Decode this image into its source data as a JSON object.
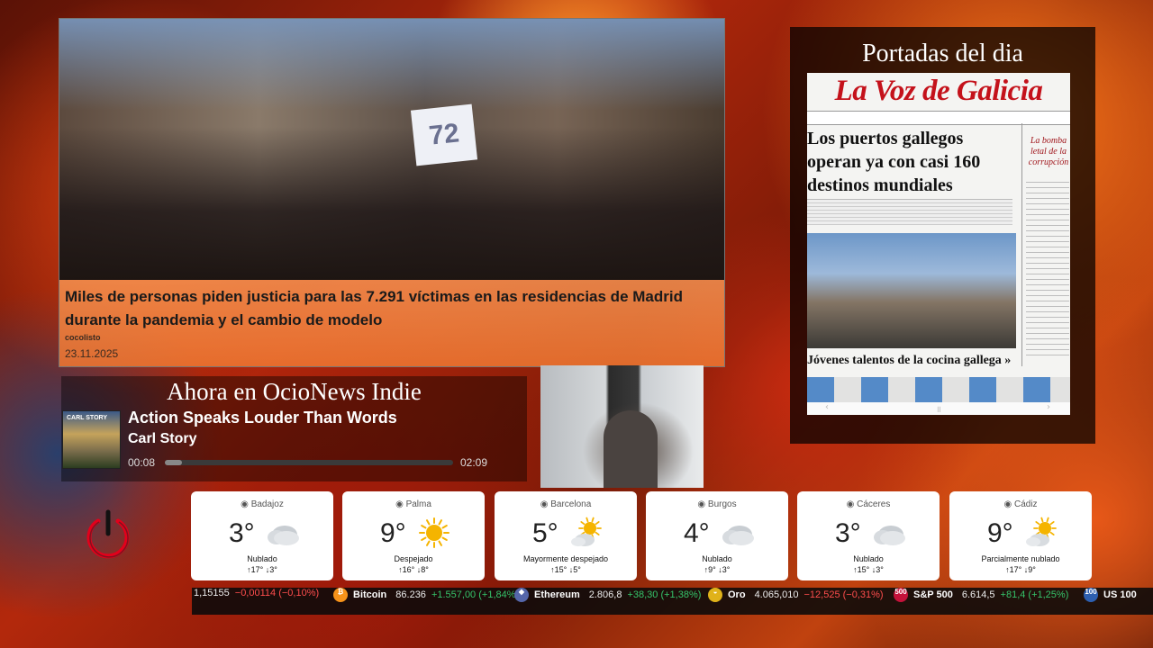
{
  "news": {
    "title": "Miles de personas piden justicia para las 7.291 víctimas en las residencias de Madrid durante la pandemia y el cambio de modelo",
    "author": "cocolisto",
    "date": "23.11.2025",
    "sign_text": "72"
  },
  "frontpages": {
    "heading": "Portadas del dia",
    "masthead": "La Voz de Galicia",
    "headline": "Los puertos gallegos operan ya con casi 160 destinos mundiales",
    "side_title": "La bomba letal de la corrupción",
    "photo_caption": "Jóvenes talentos de la cocina gallega »",
    "prev": "‹",
    "pager": "॥",
    "next": "›"
  },
  "now_playing": {
    "heading": "Ahora en OcioNews Indie",
    "cover_text": "CARL STORY",
    "track": "Action Speaks Louder Than Words",
    "artist": "Carl Story",
    "elapsed": "00:08",
    "duration": "02:09",
    "progress": 0.06
  },
  "weather": [
    {
      "city": "Badajoz",
      "temp": "3°",
      "condition": "Nublado",
      "range": "↑17° ↓3°",
      "icon": "cloud"
    },
    {
      "city": "Palma",
      "temp": "9°",
      "condition": "Despejado",
      "range": "↑16° ↓8°",
      "icon": "sun"
    },
    {
      "city": "Barcelona",
      "temp": "5°",
      "condition": "Mayormente despejado",
      "range": "↑15° ↓5°",
      "icon": "sun-cloud"
    },
    {
      "city": "Burgos",
      "temp": "4°",
      "condition": "Nublado",
      "range": "↑9° ↓3°",
      "icon": "cloud"
    },
    {
      "city": "Cáceres",
      "temp": "3°",
      "condition": "Nublado",
      "range": "↑15° ↓3°",
      "icon": "cloud"
    },
    {
      "city": "Cádiz",
      "temp": "9°",
      "condition": "Parcialmente nublado",
      "range": "↑17° ↓9°",
      "icon": "sun-cloud"
    }
  ],
  "ticker": [
    {
      "name": "",
      "price": "1,15155",
      "change": "−0,00114 (−0,10%)",
      "dir": "down",
      "badge": "",
      "color": "#000000"
    },
    {
      "name": "Bitcoin",
      "price": "86.236",
      "change": "+1.557,00 (+1,84%)",
      "dir": "up",
      "badge": "₿",
      "color": "#f7931a"
    },
    {
      "name": "Ethereum",
      "price": "2.806,8",
      "change": "+38,30 (+1,38%)",
      "dir": "up",
      "badge": "◆",
      "color": "#5566aa"
    },
    {
      "name": "Oro",
      "price": "4.065,010",
      "change": "−12,525 (−0,31%)",
      "dir": "down",
      "badge": "◒",
      "color": "#e0b21a"
    },
    {
      "name": "S&P 500",
      "price": "6.614,5",
      "change": "+81,4 (+1,25%)",
      "dir": "up",
      "badge": "500",
      "color": "#c4123a"
    },
    {
      "name": "US 100",
      "price": "",
      "change": "",
      "dir": "up",
      "badge": "100",
      "color": "#2d5fb0"
    }
  ],
  "colors": {
    "ticker_up": "#35c46a",
    "ticker_down": "#ff4d4d",
    "power": "#e3001b"
  }
}
